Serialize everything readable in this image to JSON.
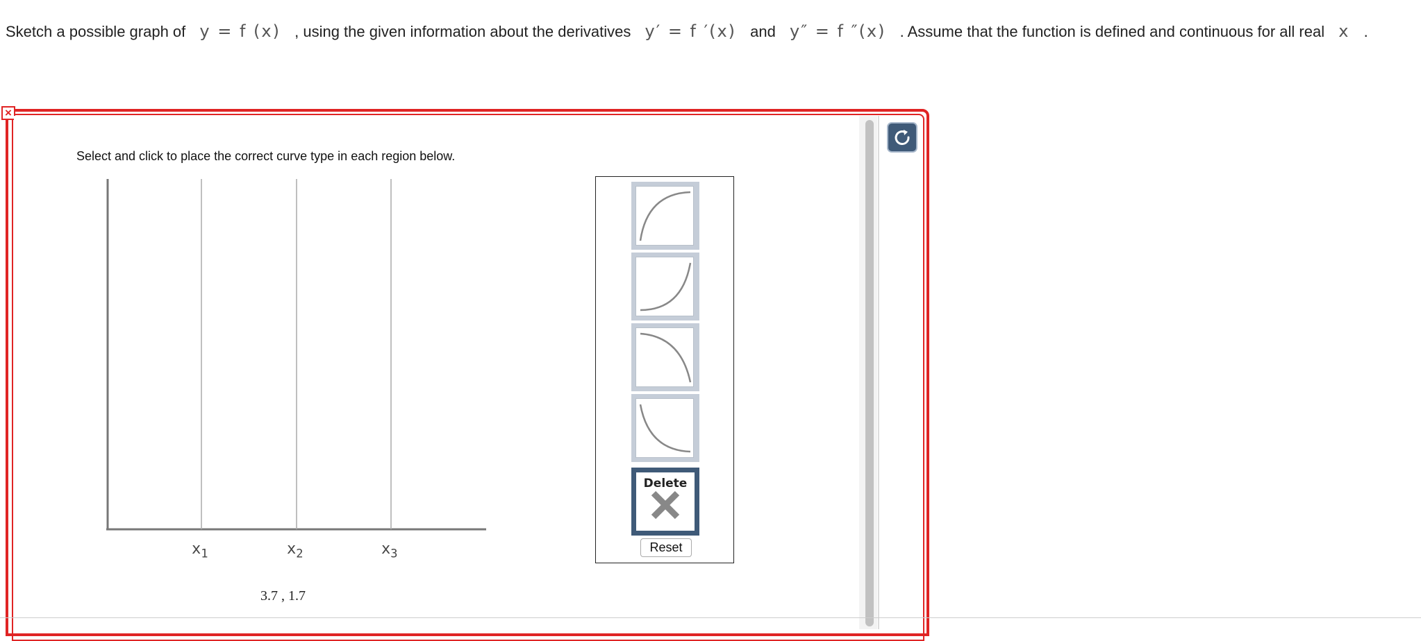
{
  "question": {
    "part1": "Sketch a possible graph of",
    "math1": "y = f (x)",
    "part2": ", using the given information about the derivatives",
    "math2": "y′ = f ′(x)",
    "part3": "and",
    "math3": "y″ = f ″(x)",
    "part4": ". Assume that the function is defined and continuous for all real",
    "math4": "x",
    "part5": "."
  },
  "instructions": "Select and click to place the correct curve type in each region below.",
  "graph": {
    "x_labels": [
      {
        "base": "x",
        "sub": "1"
      },
      {
        "base": "x",
        "sub": "2"
      },
      {
        "base": "x",
        "sub": "3"
      }
    ],
    "coordinate_readout": "3.7 , 1.7"
  },
  "palette": {
    "curves": [
      {
        "icon": "concave-down-increasing-curve-icon"
      },
      {
        "icon": "concave-up-increasing-curve-icon"
      },
      {
        "icon": "concave-down-decreasing-curve-icon"
      },
      {
        "icon": "concave-up-decreasing-curve-icon"
      }
    ],
    "delete_label": "Delete",
    "reset_label": "Reset"
  },
  "colors": {
    "frame_red": "#e02424",
    "tile_gray": "#c5cdd8",
    "delete_navy": "#3f5a78"
  }
}
